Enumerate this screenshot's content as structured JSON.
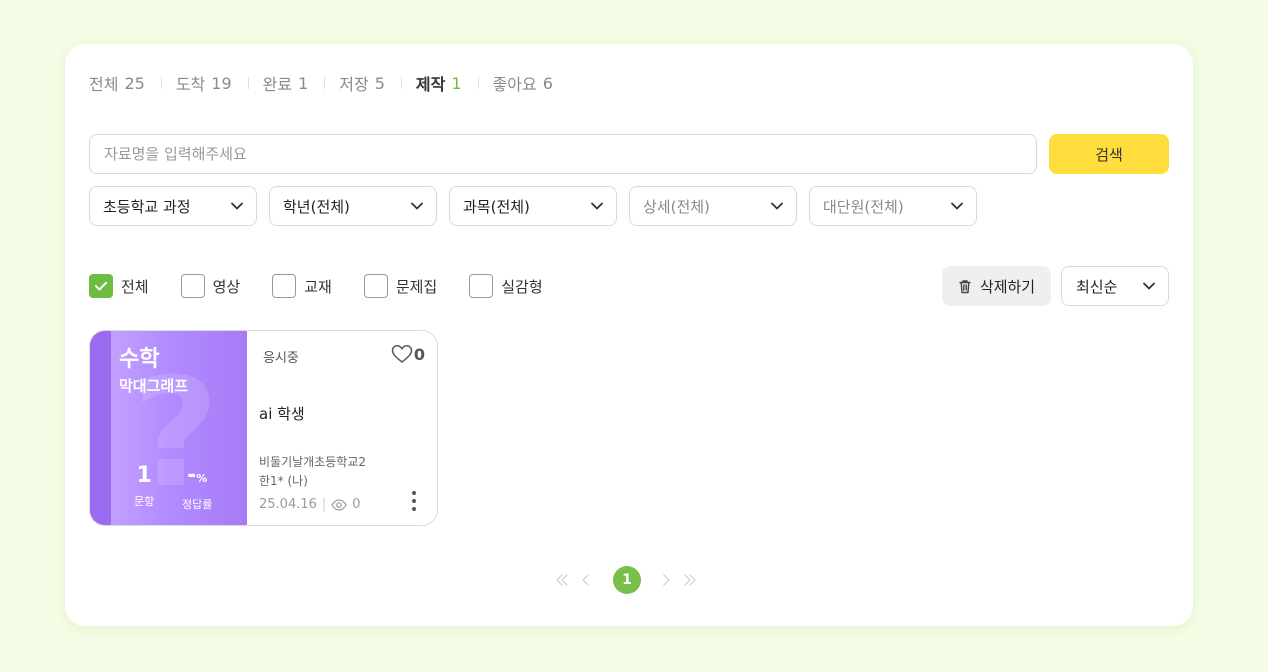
{
  "tabs": [
    {
      "label": "전체",
      "count": "25",
      "active": false
    },
    {
      "label": "도착",
      "count": "19",
      "active": false
    },
    {
      "label": "완료",
      "count": "1",
      "active": false
    },
    {
      "label": "저장",
      "count": "5",
      "active": false
    },
    {
      "label": "제작",
      "count": "1",
      "active": true
    },
    {
      "label": "좋아요",
      "count": "6",
      "active": false
    }
  ],
  "search": {
    "placeholder": "자료명을 입력해주세요",
    "value": "",
    "button_label": "검색"
  },
  "dropdowns": [
    {
      "label": "초등학교 과정",
      "muted": false
    },
    {
      "label": "학년(전체)",
      "muted": false
    },
    {
      "label": "과목(전체)",
      "muted": false
    },
    {
      "label": "상세(전체)",
      "muted": true
    },
    {
      "label": "대단원(전체)",
      "muted": true
    }
  ],
  "type_filters": [
    {
      "label": "전체",
      "checked": true
    },
    {
      "label": "영상",
      "checked": false
    },
    {
      "label": "교재",
      "checked": false
    },
    {
      "label": "문제집",
      "checked": false
    },
    {
      "label": "실감형",
      "checked": false
    }
  ],
  "actions": {
    "delete_label": "삭제하기",
    "sort_label": "최신순"
  },
  "card": {
    "subject": "수학",
    "topic": "막대그래프",
    "question_count": "1",
    "question_caption": "문항",
    "accuracy": "-",
    "accuracy_unit": "%",
    "accuracy_caption": "정답률",
    "status": "응시중",
    "likes": "0",
    "title": "ai 학생",
    "school_line1": "비둘기날개초등학교2",
    "school_line2": "한1* (나)",
    "date": "25.04.16",
    "views": "0",
    "accent_color": "#a67bf6"
  },
  "pagination": {
    "current_page": "1"
  },
  "colors": {
    "background": "#f5fde6",
    "accent_green": "#79bf4a",
    "search_button": "#ffdd3c"
  }
}
